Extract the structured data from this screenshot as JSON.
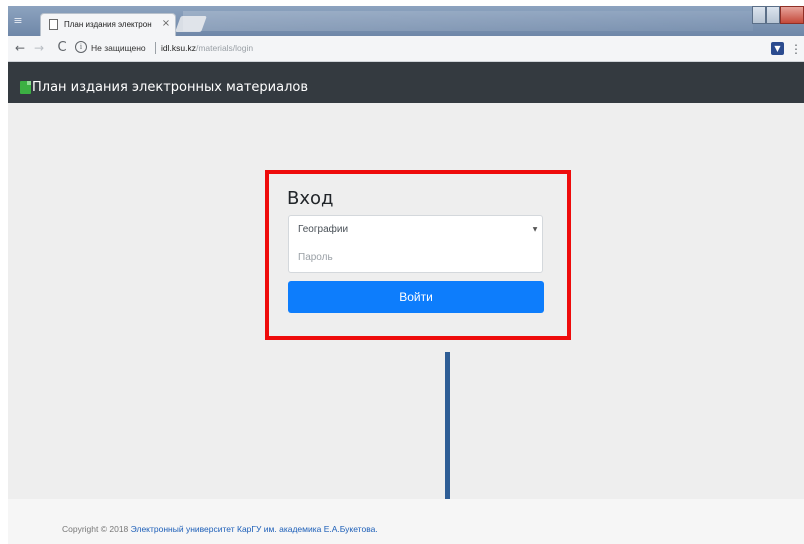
{
  "browser": {
    "tab_title": "План издания электрон",
    "tab_close": "×",
    "security_label": "Не защищено",
    "url_host": "idl.ksu.kz",
    "url_path": "/materials/login",
    "icons": {
      "menu": "≡",
      "back": "←",
      "forward": "→",
      "reload": "C",
      "info": "i",
      "extension": "▼",
      "more": "⋮"
    }
  },
  "header": {
    "brand": "План издания электронных материалов"
  },
  "login": {
    "title": "Вход",
    "faculty_selected": "Географии",
    "password_placeholder": "Пароль",
    "submit_label": "Войти"
  },
  "footer": {
    "copyright": "Copyright © 2018",
    "link_text": "Электронный университет КарГУ им. академика Е.А.Букетова."
  },
  "colors": {
    "highlight_box": "#ee0b0b",
    "primary_button": "#0d7dfc",
    "navbar": "#343a40",
    "annotation_line": "#2e5d95"
  }
}
